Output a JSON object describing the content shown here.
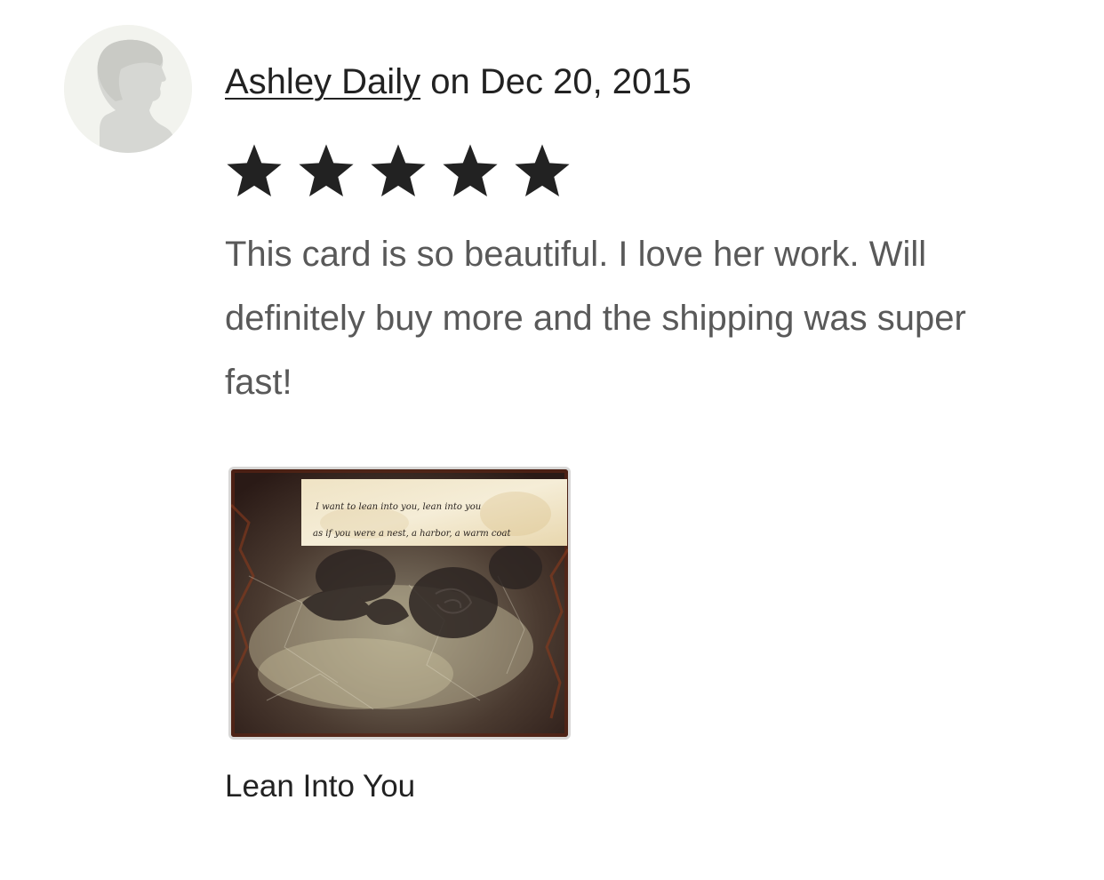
{
  "review": {
    "reviewer_name": "Ashley Daily",
    "date_prefix": "on",
    "date": "Dec 20, 2015",
    "rating": 5,
    "rating_max": 5,
    "text": "This card is so beautiful. I love her work. Will definitely buy more and the shipping was super fast!",
    "photo_caption_line1": "I want to lean into you, lean into you",
    "photo_caption_line2": "as if you were a nest, a harbor, a warm coat",
    "product_title": "Lean Into You"
  },
  "icons": {
    "avatar": "default-user-silhouette-icon",
    "star": "star-filled-icon"
  },
  "colors": {
    "text_primary": "#222222",
    "text_secondary": "#595959",
    "star": "#222222",
    "avatar_bg": "#f2f3ee",
    "avatar_silhouette": "#d6d7d3"
  }
}
